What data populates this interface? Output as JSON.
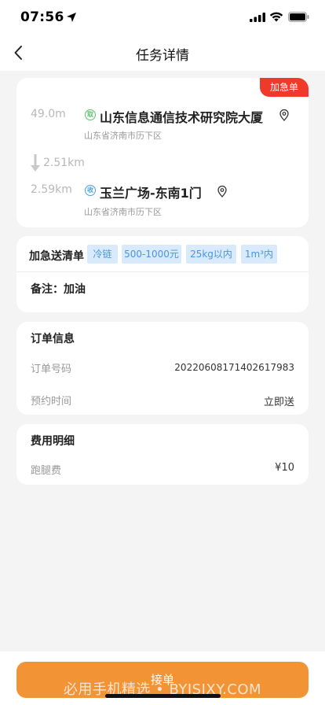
{
  "status_bar": {
    "time": "07:56"
  },
  "nav": {
    "title": "任务详情"
  },
  "route": {
    "tag": "加急单",
    "pickup": {
      "distance": "49.0m",
      "icon_label": "取",
      "name": "山东信息通信技术研究院大厦",
      "address": "山东省济南市历下区"
    },
    "between_distance": "2.51km",
    "dropoff": {
      "distance": "2.59km",
      "icon_label": "收",
      "name": "玉兰广场-东南1门",
      "address": "山东省济南市历下区"
    }
  },
  "delivery_list": {
    "title": "加急送清单",
    "chips": [
      "冷链",
      "500-1000元",
      "25kg以内",
      "1m³内"
    ],
    "note": "备注：加油"
  },
  "order_info": {
    "title": "订单信息",
    "order_no_label": "订单号码",
    "order_no_value": "20220608171402617983",
    "appointment_label": "预约时间",
    "appointment_value": "立即送"
  },
  "fee": {
    "title": "费用明细",
    "errand_label": "跑腿费",
    "errand_value": "¥10"
  },
  "bottom": {
    "accept_label": "接单",
    "watermark": "必用手机精选 • BYJSJXY.COM"
  },
  "colors": {
    "urgent": "#f0392b",
    "accent": "#f29336",
    "chip_bg": "#d8eafc",
    "chip_text": "#4a95e0",
    "pickup_icon": "#5cc36b",
    "dropoff_icon": "#4aa3df"
  }
}
